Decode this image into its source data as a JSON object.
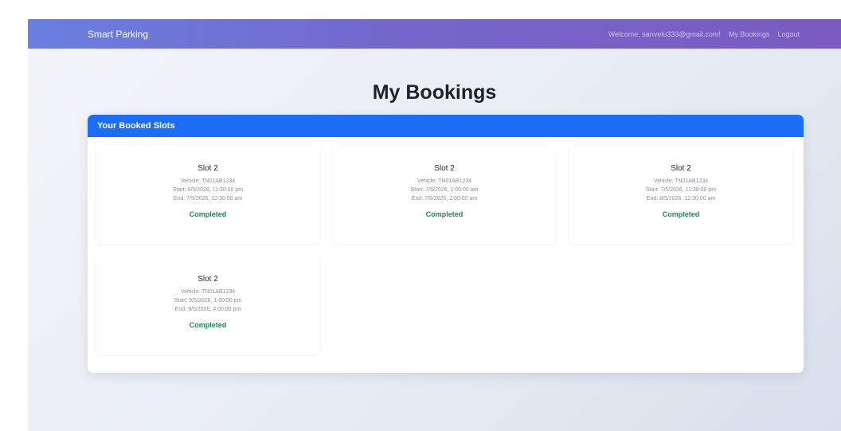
{
  "navbar": {
    "brand": "Smart Parking",
    "welcome": "Welcome, sanvelu333@gmail.com!",
    "my_bookings": "My Bookings",
    "logout": "Logout"
  },
  "page": {
    "title": "My Bookings"
  },
  "card": {
    "header": "Your Booked Slots"
  },
  "bookings": [
    {
      "slot": "Slot 2",
      "vehicle": "Vehicle: TN01AB1234",
      "start": "Start: 6/5/2026, 11:30:00 pm",
      "end": "End: 7/5/2026, 12:30:00 am",
      "status": "Completed"
    },
    {
      "slot": "Slot 2",
      "vehicle": "Vehicle: TN01AB1234",
      "start": "Start: 7/5/2026, 1:00:00 am",
      "end": "End: 7/5/2026, 2:00:00 am",
      "status": "Completed"
    },
    {
      "slot": "Slot 2",
      "vehicle": "Vehicle: TN01AB1234",
      "start": "Start: 7/5/2026, 11:30:00 pm",
      "end": "End: 8/5/2026, 12:30:00 am",
      "status": "Completed"
    },
    {
      "slot": "Slot 2",
      "vehicle": "Vehicle: TN01AB1234",
      "start": "Start: 9/5/2026, 1:00:00 pm",
      "end": "End: 9/5/2026, 4:00:00 pm",
      "status": "Completed"
    }
  ],
  "colors": {
    "card_header": "#1b6ef5",
    "status_completed": "#1f8a57",
    "navbar_start": "#6a7fdf",
    "navbar_end": "#7a5bbf"
  }
}
